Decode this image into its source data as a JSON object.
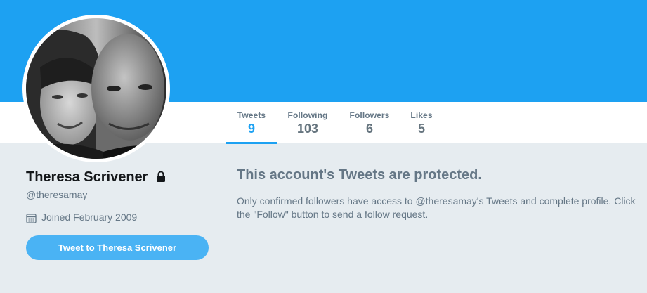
{
  "profile": {
    "name": "Theresa Scrivener",
    "handle": "@theresamay",
    "joined": "Joined February 2009",
    "tweet_button": "Tweet to Theresa Scrivener"
  },
  "nav": {
    "tweets": {
      "label": "Tweets",
      "count": "9"
    },
    "following": {
      "label": "Following",
      "count": "103"
    },
    "followers": {
      "label": "Followers",
      "count": "6"
    },
    "likes": {
      "label": "Likes",
      "count": "5"
    }
  },
  "protected": {
    "title": "This account's Tweets are protected.",
    "body": "Only confirmed followers have access to @theresamay's Tweets and complete profile. Click the \"Follow\" button to send a follow request."
  },
  "icons": {
    "lock": "lock-icon",
    "calendar": "calendar-icon"
  },
  "colors": {
    "banner": "#1da1f2",
    "accent": "#1da1f2",
    "button": "#4ab3f4",
    "background": "#e6ecf0"
  }
}
